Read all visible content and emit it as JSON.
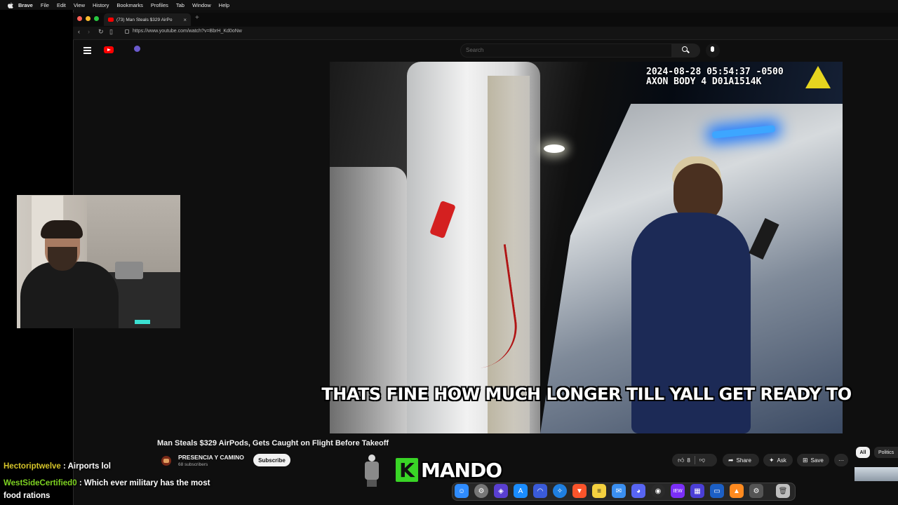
{
  "menubar": {
    "app": "Brave",
    "items": [
      "File",
      "Edit",
      "View",
      "History",
      "Bookmarks",
      "Profiles",
      "Tab",
      "Window",
      "Help"
    ]
  },
  "browser": {
    "tab_title": "(73) Man Steals $329 AirPo",
    "url": "https://www.youtube.com/watch?v=BbrH_Kd0oNw"
  },
  "youtube": {
    "search_placeholder": "Search",
    "video_title": "Man Steals $329 AirPods, Gets Caught on Flight Before Takeoff",
    "channel_name": "PRESENCIA Y CAMINO",
    "subscriber_count": "68 subscribers",
    "subscribe_label": "Subscribe",
    "like_count": "8",
    "share_label": "Share",
    "ask_label": "Ask",
    "save_label": "Save",
    "more_label": "···",
    "chips": [
      "All",
      "Politics"
    ]
  },
  "video": {
    "timestamp_line1": "2024-08-28 05:54:37 -0500",
    "timestamp_line2": "AXON BODY 4 D01A1514K",
    "caption": "THATS FINE HOW MUCH LONGER TILL YALL GET READY TO"
  },
  "chat": [
    {
      "user": "Hectoriptwelve",
      "message": ": Airports lol",
      "color": "#d6c52a"
    },
    {
      "user": "WestSideCertified0",
      "message": ": Which ever military has the most",
      "color": "#7ed321"
    },
    {
      "continuation": "food rations"
    }
  ],
  "overlay_logo": {
    "k": "K",
    "rest": "MANDO"
  },
  "colors": {
    "accent_red": "#ff0000",
    "logo_green": "#39d526",
    "bluelight": "#3da6ff"
  },
  "dock_icons": [
    "finder-icon",
    "launchpad-icon",
    "brave-shield-icon",
    "app-store-icon",
    "arc-icon",
    "safari-icon",
    "brave-icon",
    "notes-icon",
    "mail-icon",
    "discord-icon",
    "obs-icon",
    "iew-icon",
    "grid-icon",
    "desktop-icon",
    "vlc-icon",
    "settings-icon",
    "trash-icon"
  ]
}
